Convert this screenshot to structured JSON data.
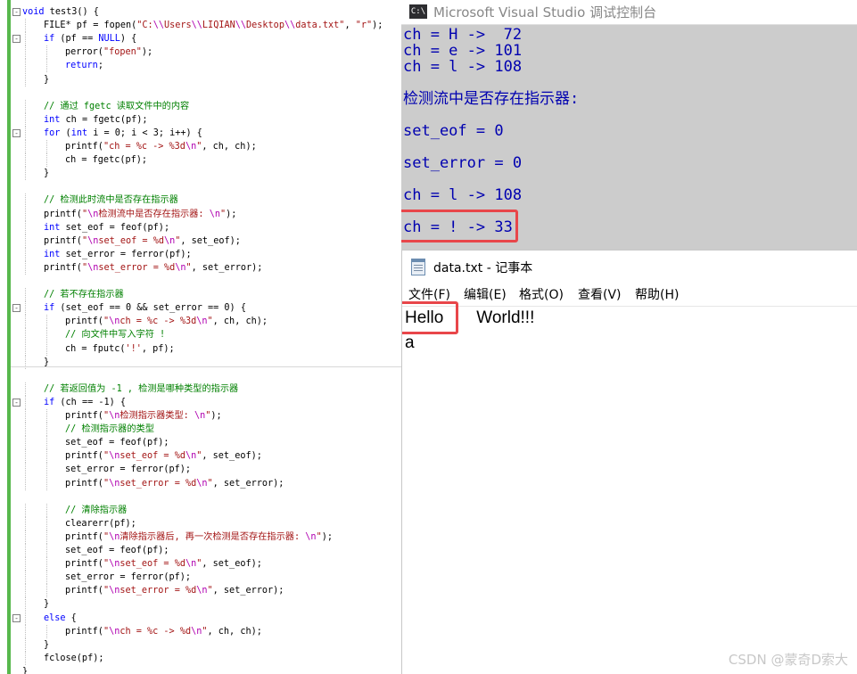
{
  "editor": {
    "lines": [
      {
        "indent": 0,
        "fold": "-",
        "tokens": [
          [
            "kw",
            "void"
          ],
          [
            "txt",
            " test3() {"
          ]
        ]
      },
      {
        "indent": 1,
        "tokens": [
          [
            "txt",
            "FILE* pf = fopen("
          ],
          [
            "str",
            "\"C:"
          ],
          [
            "esc",
            "\\\\"
          ],
          [
            "str",
            "Users"
          ],
          [
            "esc",
            "\\\\"
          ],
          [
            "str",
            "LIQIAN"
          ],
          [
            "esc",
            "\\\\"
          ],
          [
            "str",
            "Desktop"
          ],
          [
            "esc",
            "\\\\"
          ],
          [
            "str",
            "data.txt\""
          ],
          [
            "txt",
            ", "
          ],
          [
            "str",
            "\"r\""
          ],
          [
            "txt",
            ");"
          ]
        ]
      },
      {
        "indent": 1,
        "fold": "-",
        "tokens": [
          [
            "kw",
            "if"
          ],
          [
            "txt",
            " (pf == "
          ],
          [
            "kw",
            "NULL"
          ],
          [
            "txt",
            ") {"
          ]
        ]
      },
      {
        "indent": 2,
        "tokens": [
          [
            "txt",
            "perror("
          ],
          [
            "str",
            "\"fopen\""
          ],
          [
            "txt",
            ");"
          ]
        ]
      },
      {
        "indent": 2,
        "tokens": [
          [
            "kw",
            "return"
          ],
          [
            "txt",
            ";"
          ]
        ]
      },
      {
        "indent": 1,
        "tokens": [
          [
            "txt",
            "}"
          ]
        ]
      },
      {
        "indent": 0,
        "tokens": []
      },
      {
        "indent": 1,
        "tokens": [
          [
            "cm",
            "// 通过 fgetc 读取文件中的内容"
          ]
        ]
      },
      {
        "indent": 1,
        "tokens": [
          [
            "kw",
            "int"
          ],
          [
            "txt",
            " ch = fgetc(pf);"
          ]
        ]
      },
      {
        "indent": 1,
        "fold": "-",
        "tokens": [
          [
            "kw",
            "for"
          ],
          [
            "txt",
            " ("
          ],
          [
            "kw",
            "int"
          ],
          [
            "txt",
            " i = 0; i < 3; i++) {"
          ]
        ]
      },
      {
        "indent": 2,
        "tokens": [
          [
            "txt",
            "printf("
          ],
          [
            "str",
            "\"ch = %c -> %3d"
          ],
          [
            "esc",
            "\\n"
          ],
          [
            "str",
            "\""
          ],
          [
            "txt",
            ", ch, ch);"
          ]
        ]
      },
      {
        "indent": 2,
        "tokens": [
          [
            "txt",
            "ch = fgetc(pf);"
          ]
        ]
      },
      {
        "indent": 1,
        "tokens": [
          [
            "txt",
            "}"
          ]
        ]
      },
      {
        "indent": 0,
        "tokens": []
      },
      {
        "indent": 1,
        "tokens": [
          [
            "cm",
            "// 检测此时流中是否存在指示器"
          ]
        ]
      },
      {
        "indent": 1,
        "tokens": [
          [
            "txt",
            "printf("
          ],
          [
            "str",
            "\""
          ],
          [
            "esc",
            "\\n"
          ],
          [
            "str",
            "检测流中是否存在指示器: "
          ],
          [
            "esc",
            "\\n"
          ],
          [
            "str",
            "\""
          ],
          [
            "txt",
            ");"
          ]
        ]
      },
      {
        "indent": 1,
        "tokens": [
          [
            "kw",
            "int"
          ],
          [
            "txt",
            " set_eof = feof(pf);"
          ]
        ]
      },
      {
        "indent": 1,
        "tokens": [
          [
            "txt",
            "printf("
          ],
          [
            "str",
            "\""
          ],
          [
            "esc",
            "\\n"
          ],
          [
            "str",
            "set_eof = %d"
          ],
          [
            "esc",
            "\\n"
          ],
          [
            "str",
            "\""
          ],
          [
            "txt",
            ", set_eof);"
          ]
        ]
      },
      {
        "indent": 1,
        "tokens": [
          [
            "kw",
            "int"
          ],
          [
            "txt",
            " set_error = ferror(pf);"
          ]
        ]
      },
      {
        "indent": 1,
        "tokens": [
          [
            "txt",
            "printf("
          ],
          [
            "str",
            "\""
          ],
          [
            "esc",
            "\\n"
          ],
          [
            "str",
            "set_error = %d"
          ],
          [
            "esc",
            "\\n"
          ],
          [
            "str",
            "\""
          ],
          [
            "txt",
            ", set_error);"
          ]
        ]
      },
      {
        "indent": 0,
        "tokens": []
      },
      {
        "indent": 1,
        "tokens": [
          [
            "cm",
            "// 若不存在指示器"
          ]
        ]
      },
      {
        "indent": 1,
        "fold": "-",
        "tokens": [
          [
            "kw",
            "if"
          ],
          [
            "txt",
            " (set_eof == 0 && set_error == 0) {"
          ]
        ]
      },
      {
        "indent": 2,
        "tokens": [
          [
            "txt",
            "printf("
          ],
          [
            "str",
            "\""
          ],
          [
            "esc",
            "\\n"
          ],
          [
            "str",
            "ch = %c -> %3d"
          ],
          [
            "esc",
            "\\n"
          ],
          [
            "str",
            "\""
          ],
          [
            "txt",
            ", ch, ch);"
          ]
        ]
      },
      {
        "indent": 2,
        "tokens": [
          [
            "cm",
            "// 向文件中写入字符 !"
          ]
        ]
      },
      {
        "indent": 2,
        "tokens": [
          [
            "txt",
            "ch = fputc("
          ],
          [
            "str",
            "'!'"
          ],
          [
            "txt",
            ", pf);"
          ]
        ]
      },
      {
        "indent": 1,
        "tokens": [
          [
            "txt",
            "}"
          ]
        ]
      },
      {
        "indent": 0,
        "tokens": []
      },
      {
        "indent": 1,
        "tokens": [
          [
            "cm",
            "// 若返回值为 -1 , 检测是哪种类型的指示器"
          ]
        ]
      },
      {
        "indent": 1,
        "fold": "-",
        "tokens": [
          [
            "kw",
            "if"
          ],
          [
            "txt",
            " (ch == -1) {"
          ]
        ]
      },
      {
        "indent": 2,
        "tokens": [
          [
            "txt",
            "printf("
          ],
          [
            "str",
            "\""
          ],
          [
            "esc",
            "\\n"
          ],
          [
            "str",
            "检测指示器类型: "
          ],
          [
            "esc",
            "\\n"
          ],
          [
            "str",
            "\""
          ],
          [
            "txt",
            ");"
          ]
        ]
      },
      {
        "indent": 2,
        "tokens": [
          [
            "cm",
            "// 检测指示器的类型"
          ]
        ]
      },
      {
        "indent": 2,
        "tokens": [
          [
            "txt",
            "set_eof = feof(pf);"
          ]
        ]
      },
      {
        "indent": 2,
        "tokens": [
          [
            "txt",
            "printf("
          ],
          [
            "str",
            "\""
          ],
          [
            "esc",
            "\\n"
          ],
          [
            "str",
            "set_eof = %d"
          ],
          [
            "esc",
            "\\n"
          ],
          [
            "str",
            "\""
          ],
          [
            "txt",
            ", set_eof);"
          ]
        ]
      },
      {
        "indent": 2,
        "tokens": [
          [
            "txt",
            "set_error = ferror(pf);"
          ]
        ]
      },
      {
        "indent": 2,
        "tokens": [
          [
            "txt",
            "printf("
          ],
          [
            "str",
            "\""
          ],
          [
            "esc",
            "\\n"
          ],
          [
            "str",
            "set_error = %d"
          ],
          [
            "esc",
            "\\n"
          ],
          [
            "str",
            "\""
          ],
          [
            "txt",
            ", set_error);"
          ]
        ]
      },
      {
        "indent": 0,
        "tokens": []
      },
      {
        "indent": 2,
        "tokens": [
          [
            "cm",
            "// 清除指示器"
          ]
        ]
      },
      {
        "indent": 2,
        "tokens": [
          [
            "txt",
            "clearerr(pf);"
          ]
        ]
      },
      {
        "indent": 2,
        "tokens": [
          [
            "txt",
            "printf("
          ],
          [
            "str",
            "\""
          ],
          [
            "esc",
            "\\n"
          ],
          [
            "str",
            "清除指示器后, 再一次检测是否存在指示器: "
          ],
          [
            "esc",
            "\\n"
          ],
          [
            "str",
            "\""
          ],
          [
            "txt",
            ");"
          ]
        ]
      },
      {
        "indent": 2,
        "tokens": [
          [
            "txt",
            "set_eof = feof(pf);"
          ]
        ]
      },
      {
        "indent": 2,
        "tokens": [
          [
            "txt",
            "printf("
          ],
          [
            "str",
            "\""
          ],
          [
            "esc",
            "\\n"
          ],
          [
            "str",
            "set_eof = %d"
          ],
          [
            "esc",
            "\\n"
          ],
          [
            "str",
            "\""
          ],
          [
            "txt",
            ", set_eof);"
          ]
        ]
      },
      {
        "indent": 2,
        "tokens": [
          [
            "txt",
            "set_error = ferror(pf);"
          ]
        ]
      },
      {
        "indent": 2,
        "tokens": [
          [
            "txt",
            "printf("
          ],
          [
            "str",
            "\""
          ],
          [
            "esc",
            "\\n"
          ],
          [
            "str",
            "set_error = %d"
          ],
          [
            "esc",
            "\\n"
          ],
          [
            "str",
            "\""
          ],
          [
            "txt",
            ", set_error);"
          ]
        ]
      },
      {
        "indent": 1,
        "tokens": [
          [
            "txt",
            "}"
          ]
        ]
      },
      {
        "indent": 1,
        "fold": "-",
        "tokens": [
          [
            "kw",
            "else"
          ],
          [
            "txt",
            " {"
          ]
        ]
      },
      {
        "indent": 2,
        "tokens": [
          [
            "txt",
            "printf("
          ],
          [
            "str",
            "\""
          ],
          [
            "esc",
            "\\n"
          ],
          [
            "str",
            "ch = %c -> %d"
          ],
          [
            "esc",
            "\\n"
          ],
          [
            "str",
            "\""
          ],
          [
            "txt",
            ", ch, ch);"
          ]
        ]
      },
      {
        "indent": 1,
        "tokens": [
          [
            "txt",
            "}"
          ]
        ]
      },
      {
        "indent": 1,
        "tokens": [
          [
            "txt",
            "fclose(pf);"
          ]
        ]
      },
      {
        "indent": 0,
        "tokens": [
          [
            "txt",
            "}"
          ]
        ]
      }
    ]
  },
  "console": {
    "title": "Microsoft Visual Studio 调试控制台",
    "icon_label": "C:\\",
    "lines": [
      "ch = H ->  72",
      "ch = e -> 101",
      "ch = l -> 108",
      "",
      "检测流中是否存在指示器:",
      "",
      "set_eof = 0",
      "",
      "set_error = 0",
      "",
      "ch = l -> 108",
      "",
      "ch = ! -> 33"
    ]
  },
  "notepad": {
    "title": "data.txt - 记事本",
    "menu": [
      "文件(F)",
      "编辑(E)",
      "格式(O)",
      "查看(V)",
      "帮助(H)"
    ],
    "lines": [
      "Hello       World!!!",
      "a"
    ]
  },
  "watermark": "CSDN @蒙奇D索大",
  "colors": {
    "highlight": "#e8464a",
    "console_text": "#0000b0",
    "console_bg": "#cccccc",
    "gutter_green": "#57b84c",
    "keyword": "#0000ff",
    "string": "#a31515",
    "comment": "#008000",
    "escape": "#b000b0"
  }
}
